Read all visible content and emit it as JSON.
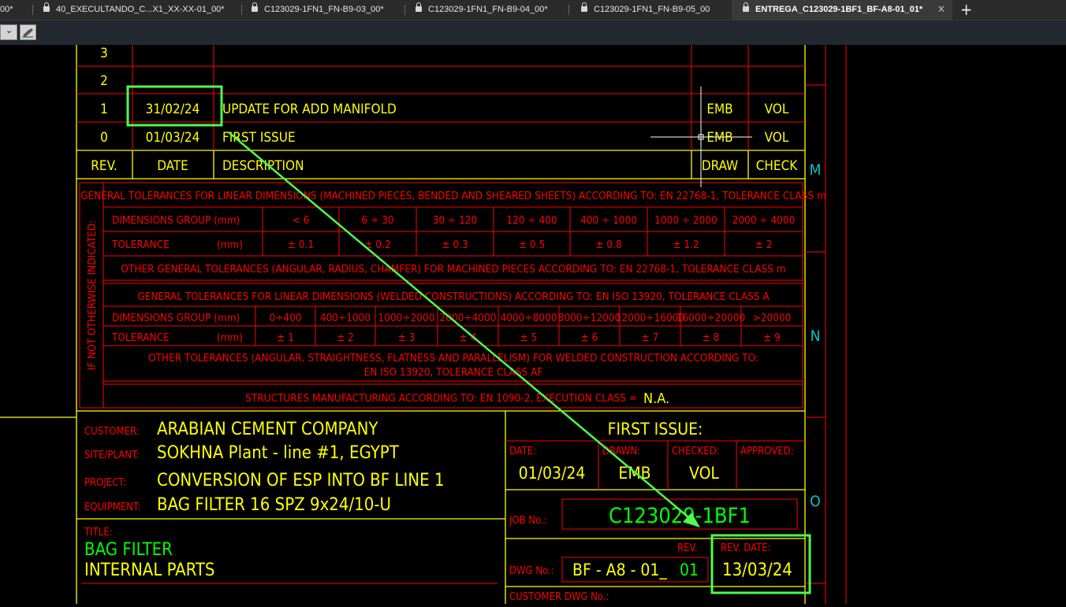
{
  "tabs": [
    {
      "label": "00*",
      "locked": false
    },
    {
      "label": "40_EXECULTANDO_C...X1_XX-XX-01_00*",
      "locked": true
    },
    {
      "label": "C123029-1FN1_FN-B9-03_00*",
      "locked": true
    },
    {
      "label": "C123029-1FN1_FN-B9-04_00*",
      "locked": true
    },
    {
      "label": "C123029-1FN1_FN-B9-05_00",
      "locked": true
    },
    {
      "label": "ENTREGA_C123029-1BF1_BF-A8-01_01*",
      "locked": true,
      "active": true
    }
  ],
  "tab_close": "✕",
  "new_tab": "+",
  "toolbar": {
    "dropdown_arrow": "⌄"
  },
  "revision_table": {
    "rows": [
      {
        "rev": "3",
        "date": "",
        "description": "",
        "draw": "",
        "check": ""
      },
      {
        "rev": "2",
        "date": "",
        "description": "",
        "draw": "",
        "check": ""
      },
      {
        "rev": "1",
        "date": "31/02/24",
        "description": "UPDATE FOR ADD MANIFOLD",
        "draw": "EMB",
        "check": "VOL"
      },
      {
        "rev": "0",
        "date": "01/03/24",
        "description": "FIRST ISSUE",
        "draw": "EMB",
        "check": "VOL"
      }
    ],
    "headers": {
      "rev": "REV.",
      "date": "DATE",
      "description": "DESCRIPTION",
      "draw": "DRAW",
      "check": "CHECK"
    }
  },
  "tolerances": {
    "side_label": "IF NOT OTHERWISE INDICATED:",
    "linear_machined_title": "GENERAL TOLERANCES FOR LINEAR DIMENSIONS (MACHINED PIECES, BENDED AND SHEARED SHEETS) ACCORDING TO:  EN 22768-1, TOLERANCE CLASS m",
    "machined_groups_label": "DIMENSIONS GROUP  (mm)",
    "machined_groups": [
      "< 6",
      "6 ÷ 30",
      "30 ÷ 120",
      "120 ÷ 400",
      "400 ÷ 1000",
      "1000 ÷ 2000",
      "2000 ÷ 4000"
    ],
    "machined_tol_label": "TOLERANCE",
    "machined_tol_unit": "(mm)",
    "machined_tolerances": [
      "± 0.1",
      "± 0.2",
      "± 0.3",
      "± 0.5",
      "± 0.8",
      "± 1.2",
      "± 2"
    ],
    "other_machined": "OTHER GENERAL TOLERANCES (ANGULAR, RADIUS, CHAMFER) FOR MACHINED PIECES ACCORDING TO:  EN 22768-1, TOLERANCE CLASS m",
    "linear_welded_title": "GENERAL TOLERANCES FOR LINEAR DIMENSIONS (WELDED CONSTRUCTIONS) ACCORDING TO: EN ISO 13920, TOLERANCE CLASS A",
    "welded_groups_label": "DIMENSIONS GROUP  (mm)",
    "welded_groups": [
      "0÷400",
      "400÷1000",
      "1000÷2000",
      "2000÷4000",
      "4000÷8000",
      "8000÷12000",
      "12000÷16000",
      "16000÷20000",
      ">20000"
    ],
    "welded_tol_label": "TOLERANCE",
    "welded_tol_unit": "(mm)",
    "welded_tolerances": [
      "± 1",
      "± 2",
      "± 3",
      "± 4",
      "± 5",
      "± 6",
      "± 7",
      "± 8",
      "± 9"
    ],
    "other_welded_line1": "OTHER TOLERANCES (ANGULAR, STRAIGHTNESS, FLATNESS AND PARALLELISM) FOR WELDED CONSTRUCTION ACCORDING TO:",
    "other_welded_line2": "EN ISO 13920, TOLERANCE CLASS AF",
    "structures": "STRUCTURES MANUFACTURING ACCORDING TO:  EN 1090-2, EXECUTION CLASS =",
    "structures_value": "N.A."
  },
  "title_block": {
    "customer_label": "CUSTOMER:",
    "customer": "ARABIAN CEMENT COMPANY",
    "site_label": "SITE/PLANT:",
    "site": "SOKHNA Plant - line #1, EGYPT",
    "project_label": "PROJECT:",
    "project": "CONVERSION OF ESP INTO BF LINE 1",
    "equipment_label": "EQUIPMENT:",
    "equipment": "BAG FILTER 16 SPZ 9x24/10-U",
    "title_label": "TITLE:",
    "title_line1": "BAG FILTER",
    "title_line2": "INTERNAL PARTS",
    "first_issue": "FIRST ISSUE:",
    "date_label": "DATE:",
    "date": "01/03/24",
    "drawn_label": "DRAWN:",
    "drawn": "EMB",
    "checked_label": "CHECKED:",
    "checked": "VOL",
    "approved_label": "APPROVED:",
    "approved": "",
    "job_label": "JOB No.:",
    "job": "C123029-1BF1",
    "dwg_label": "DWG No.:",
    "dwg": "BF - A8 - 01_",
    "dwg_rev": "01",
    "rev_label": "REV.",
    "rev_date_label": "REV. DATE:",
    "rev_date": "13/03/24",
    "customer_dwg_label": "CUSTOMER DWG No.:"
  },
  "grid_letters": [
    "M",
    "N",
    "O"
  ],
  "colors": {
    "yellow": "#ffff00",
    "red": "#ff0000",
    "green": "#00ff00",
    "highlight": "#4cff4c",
    "cyan": "#00c8c8",
    "background": "#000000"
  }
}
